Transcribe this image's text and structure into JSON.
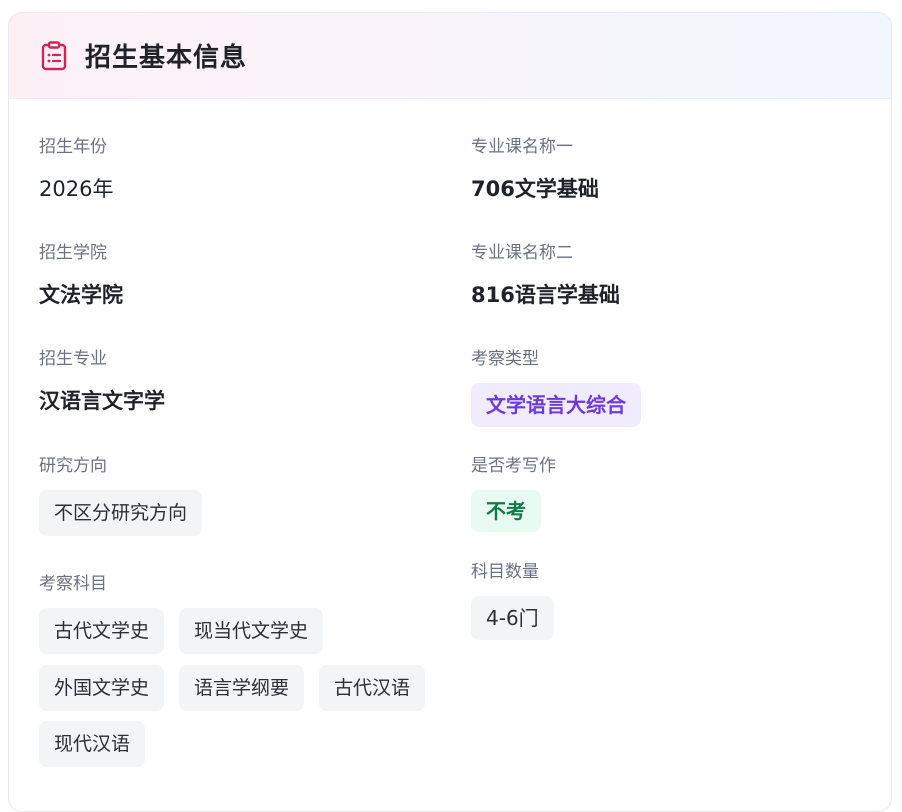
{
  "header": {
    "title": "招生基本信息",
    "icon": "clipboard-list-icon",
    "icon_color": "#d0245a"
  },
  "left": {
    "year": {
      "label": "招生年份",
      "value": "2026年"
    },
    "college": {
      "label": "招生学院",
      "value": "文法学院"
    },
    "major": {
      "label": "招生专业",
      "value": "汉语言文字学"
    },
    "direction": {
      "label": "研究方向",
      "value": "不区分研究方向"
    },
    "subjects": {
      "label": "考察科目",
      "items": [
        "古代文学史",
        "现当代文学史",
        "外国文学史",
        "语言学纲要",
        "古代汉语",
        "现代汉语"
      ]
    }
  },
  "right": {
    "course1": {
      "label": "专业课名称一",
      "value": "706文学基础"
    },
    "course2": {
      "label": "专业课名称二",
      "value": "816语言学基础"
    },
    "exam_type": {
      "label": "考察类型",
      "value": "文学语言大综合"
    },
    "writing": {
      "label": "是否考写作",
      "value": "不考"
    },
    "subject_count": {
      "label": "科目数量",
      "value": "4-6门"
    }
  },
  "colors": {
    "purple_tag_bg": "#f1ecfd",
    "purple_tag_text": "#6d3ad9",
    "green_tag_bg": "#e8faf1",
    "green_tag_text": "#107a4a",
    "neutral_tag_bg": "#f3f4f6"
  }
}
